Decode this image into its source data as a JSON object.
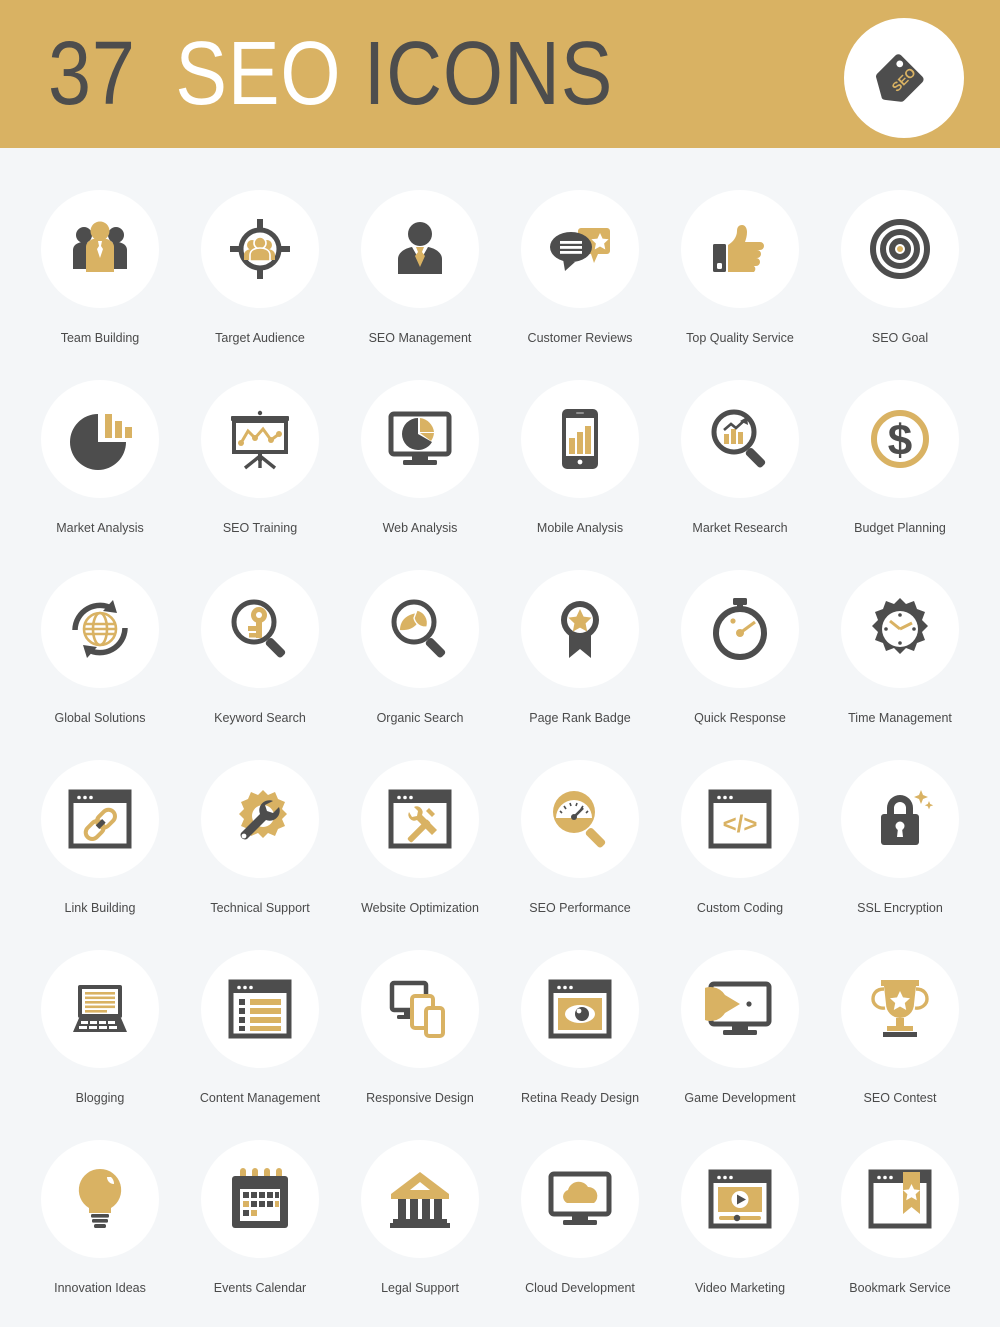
{
  "colors": {
    "header_bg": "#d9b263",
    "page_bg": "#f4f6f8",
    "disc_bg": "#ffffff",
    "dark": "#4d4d4d",
    "gold": "#d9b263",
    "gold_light": "#dfb96b",
    "label": "#4a4a4a"
  },
  "header": {
    "count": "37",
    "word_highlight": "SEO",
    "word_plain": "ICONS",
    "badge_icon": "seo-tag-icon",
    "badge_text": "SEO"
  },
  "grid": {
    "columns": 6,
    "rows": 6,
    "icons": [
      {
        "label": "Team Building",
        "icon": "team-icon"
      },
      {
        "label": "Target Audience",
        "icon": "crosshair-people-icon"
      },
      {
        "label": "SEO Management",
        "icon": "businessman-icon"
      },
      {
        "label": "Customer Reviews",
        "icon": "speech-bubbles-star-icon"
      },
      {
        "label": "Top Quality Service",
        "icon": "thumbs-up-icon"
      },
      {
        "label": "SEO Goal",
        "icon": "target-rings-icon"
      },
      {
        "label": "Market Analysis",
        "icon": "pie-bar-chart-icon"
      },
      {
        "label": "SEO Training",
        "icon": "presentation-screen-icon"
      },
      {
        "label": "Web Analysis",
        "icon": "monitor-pie-icon"
      },
      {
        "label": "Mobile Analysis",
        "icon": "tablet-bars-icon"
      },
      {
        "label": "Market Research",
        "icon": "magnifier-growth-icon"
      },
      {
        "label": "Budget Planning",
        "icon": "dollar-coin-icon"
      },
      {
        "label": "Global Solutions",
        "icon": "globe-arrows-icon"
      },
      {
        "label": "Keyword Search",
        "icon": "magnifier-key-icon"
      },
      {
        "label": "Organic Search",
        "icon": "magnifier-leaf-icon"
      },
      {
        "label": "Page Rank Badge",
        "icon": "ribbon-star-icon"
      },
      {
        "label": "Quick Response",
        "icon": "stopwatch-icon"
      },
      {
        "label": "Time Management",
        "icon": "gear-clock-icon"
      },
      {
        "label": "Link Building",
        "icon": "browser-chain-icon"
      },
      {
        "label": "Technical Support",
        "icon": "gear-wrench-icon"
      },
      {
        "label": "Website Optimization",
        "icon": "browser-tools-icon"
      },
      {
        "label": "SEO Performance",
        "icon": "magnifier-gauge-icon"
      },
      {
        "label": "Custom Coding",
        "icon": "browser-code-icon"
      },
      {
        "label": "SSL Encryption",
        "icon": "padlock-sparkle-icon"
      },
      {
        "label": "Blogging",
        "icon": "laptop-text-icon"
      },
      {
        "label": "Content Management",
        "icon": "browser-list-icon"
      },
      {
        "label": "Responsive Design",
        "icon": "devices-icon"
      },
      {
        "label": "Retina Ready Design",
        "icon": "browser-eye-icon"
      },
      {
        "label": "Game Development",
        "icon": "monitor-pacman-icon"
      },
      {
        "label": "SEO Contest",
        "icon": "trophy-icon"
      },
      {
        "label": "Innovation Ideas",
        "icon": "lightbulb-icon"
      },
      {
        "label": "Events Calendar",
        "icon": "calendar-icon"
      },
      {
        "label": "Legal Support",
        "icon": "courthouse-icon"
      },
      {
        "label": "Cloud Development",
        "icon": "monitor-cloud-icon"
      },
      {
        "label": "Video Marketing",
        "icon": "browser-video-icon"
      },
      {
        "label": "Bookmark Service",
        "icon": "browser-bookmark-icon"
      }
    ]
  }
}
